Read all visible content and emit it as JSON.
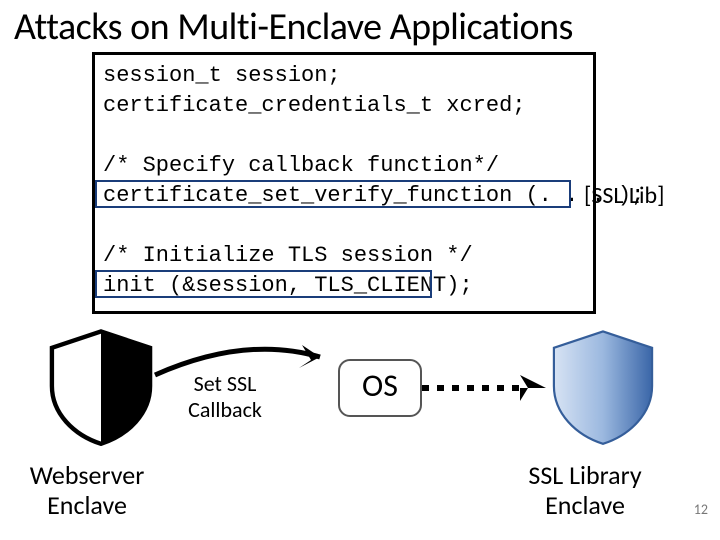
{
  "title": "Attacks on Multi-Enclave Applications",
  "code": {
    "l1": "session_t session;",
    "l2": "certificate_credentials_t xcred;",
    "l3": "",
    "l4": "/* Specify callback function*/",
    "l5": "certificate_set_verify_function (. . . );",
    "l6": "",
    "l7": "/* Initialize TLS session */",
    "l8": "init (&session, TLS_CLIENT);"
  },
  "annotation": {
    "ssl_lib": "[SSL Lib]"
  },
  "labels": {
    "set_callback": "Set SSL Callback",
    "os": "OS",
    "webserver": "Webserver Enclave",
    "ssl_library": "SSL Library Enclave"
  },
  "page_number": "12"
}
